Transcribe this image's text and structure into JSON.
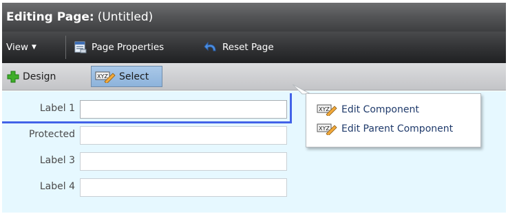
{
  "header": {
    "title_label": "Editing Page:",
    "title_value": "(Untitled)"
  },
  "toolbar": {
    "view_label": "View",
    "page_properties_label": "Page Properties",
    "reset_page_label": "Reset Page"
  },
  "modes": {
    "design_label": "Design",
    "select_label": "Select",
    "active": "Select"
  },
  "form": {
    "fields": [
      {
        "label": "Label 1",
        "value": ""
      },
      {
        "label": "Protected",
        "value": ""
      },
      {
        "label": "Label 3",
        "value": ""
      },
      {
        "label": "Label 4",
        "value": ""
      }
    ]
  },
  "context_menu": {
    "items": [
      {
        "label": "Edit Component",
        "icon": "xyz-edit-icon"
      },
      {
        "label": "Edit Parent Component",
        "icon": "xyz-edit-icon"
      }
    ]
  },
  "colors": {
    "selection_outline": "#4262e8",
    "canvas_background": "#e6f8ff",
    "active_mode": "#9dbfe3"
  }
}
